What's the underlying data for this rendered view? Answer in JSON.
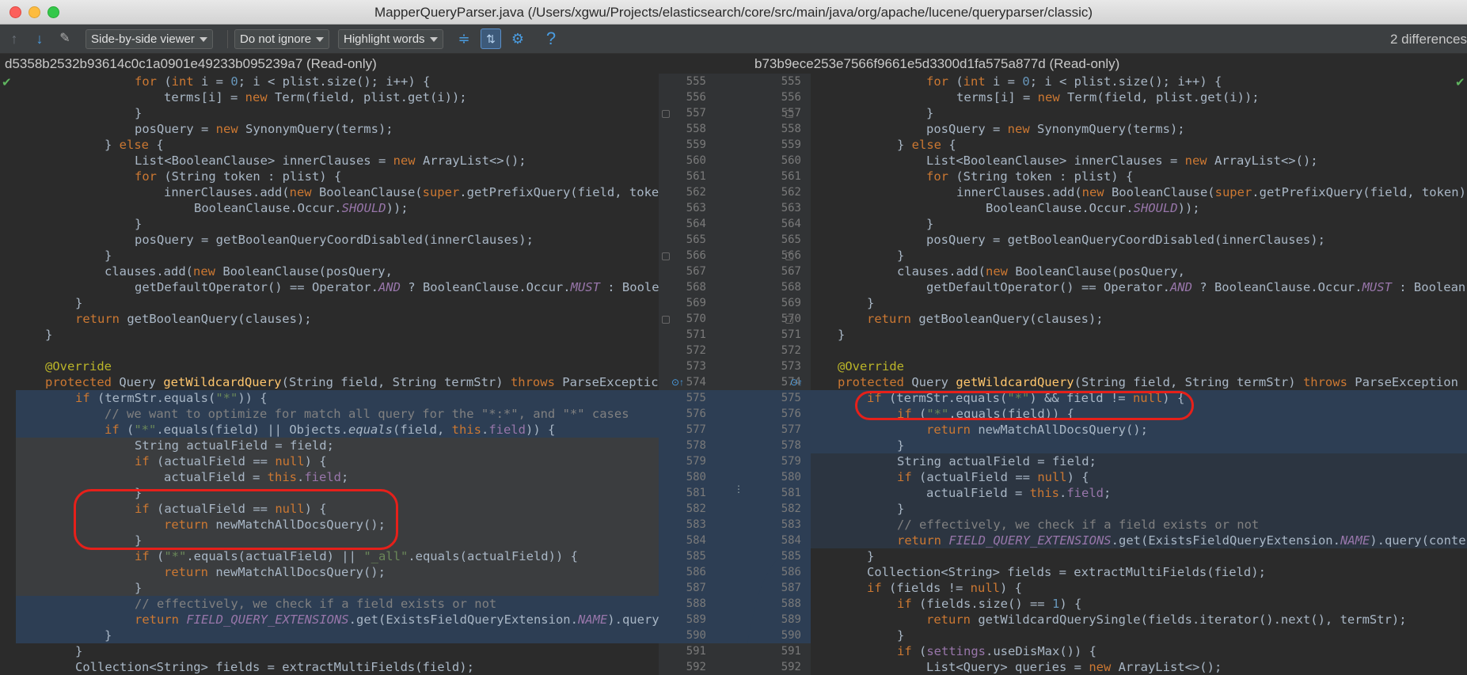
{
  "window": {
    "title": "MapperQueryParser.java (/Users/xgwu/Projects/elasticsearch/core/src/main/java/org/apache/lucene/queryparser/classic)"
  },
  "toolbar": {
    "viewer_mode": "Side-by-side viewer",
    "whitespace_mode": "Do not ignore",
    "highlight_mode": "Highlight words",
    "differences_count": "2 differences"
  },
  "left_panel": {
    "header": "d5358b2532b93614c0c1a0901e49233b095239a7 (Read-only)"
  },
  "right_panel": {
    "header": "b73b9ece253e7566f9661e5d3300d1fa575a877d (Read-only)"
  },
  "gutter": {
    "left_numbers": [
      "555",
      "556",
      "557",
      "558",
      "559",
      "560",
      "561",
      "562",
      "563",
      "564",
      "565",
      "566",
      "567",
      "568",
      "569",
      "570",
      "571",
      "572",
      "573",
      "574",
      "575",
      "576",
      "577",
      "578",
      "579",
      "580",
      "581",
      "582",
      "583",
      "584",
      "585",
      "586",
      "587",
      "588",
      "589",
      "590",
      "591",
      "592"
    ],
    "right_numbers": [
      "555",
      "556",
      "557",
      "558",
      "559",
      "560",
      "561",
      "562",
      "563",
      "564",
      "565",
      "566",
      "567",
      "568",
      "569",
      "570",
      "571",
      "572",
      "573",
      "574",
      "575",
      "576",
      "577",
      "578",
      "579",
      "580",
      "581",
      "582",
      "583",
      "584",
      "585",
      "586",
      "587",
      "588",
      "589",
      "590",
      "591",
      "592"
    ]
  },
  "icons": {
    "prev": "arrow-up-icon",
    "next": "arrow-down-icon",
    "edit": "edit-source-icon",
    "collapse": "collapse-unchanged-icon",
    "sync": "sync-scroll-icon",
    "settings": "gear-icon",
    "help": "help-icon"
  },
  "colors": {
    "changed_bg": "#2d3e54",
    "deleted_bg": "#3b3d3f",
    "annotation_circle": "#e6201a"
  }
}
